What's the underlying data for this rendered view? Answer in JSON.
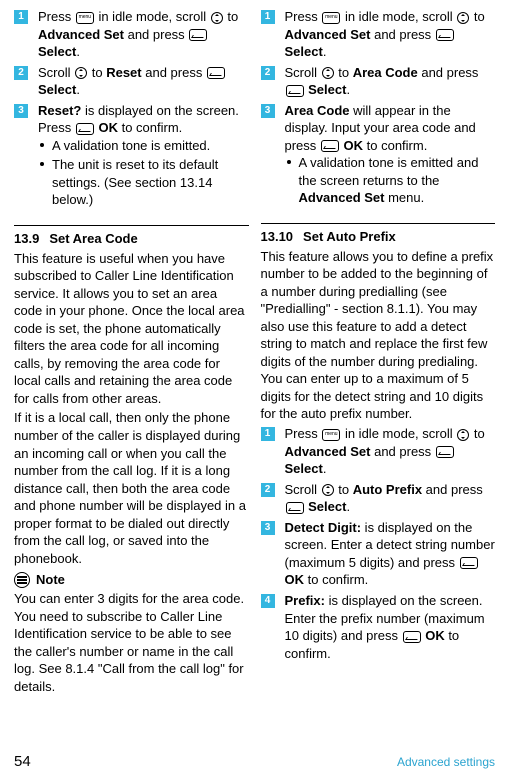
{
  "icons": {
    "menu_text": "menu"
  },
  "left_top_steps": {
    "s1": {
      "num": "1",
      "a": "Press ",
      "b": " in idle mode, scroll ",
      "c": " to",
      "d": "Advanced Set",
      "e": " and press ",
      "f": "Select",
      "g": "."
    },
    "s2": {
      "num": "2",
      "a": "Scroll ",
      "b": " to ",
      "c": "Reset",
      "d": " and press ",
      "e": "Select",
      "f": "."
    },
    "s3": {
      "num": "3",
      "a": "Reset?",
      "b": " is displayed on the screen.",
      "c": "Press ",
      "d": "OK",
      "e": " to confirm."
    },
    "b1": "A validation tone is emitted.",
    "b2": "The unit is reset to its default settings. (See section 13.14 below.)"
  },
  "right_top_steps": {
    "s1": {
      "num": "1",
      "a": "Press ",
      "b": " in idle mode, scroll ",
      "c": " to",
      "d": "Advanced Set",
      "e": " and press ",
      "f": "Select",
      "g": "."
    },
    "s2": {
      "num": "2",
      "a": "Scroll ",
      "b": " to ",
      "c": "Area Code",
      "d": " and press",
      "e": "Select",
      "f": "."
    },
    "s3": {
      "num": "3",
      "a": "Area Code",
      "b": " will appear in the display. Input your area code and press ",
      "c": "OK",
      "d": " to confirm."
    },
    "b1a": "A validation tone is emitted and the screen returns to the",
    "b1b": "Advanced Set",
    "b1c": " menu."
  },
  "left_section": {
    "num": "13.9",
    "title": "Set Area Code",
    "p1": "This feature is useful when you have subscribed to Caller Line Identification service. It allows you to set an area code in your phone. Once the local area code is set, the phone automatically filters the area code for all incoming calls, by removing the area code for local calls and retaining the area code for calls from other areas.",
    "p2": "If it is a local call, then only the phone number of the caller is displayed during an incoming call or when you call the number from the call log. If it is a long distance call, then both the area code and phone number will be displayed in a proper format to be dialed out directly from the call log, or saved into the phonebook.",
    "note_label": "Note",
    "note": "You can enter 3 digits for the area code. You need to subscribe to Caller Line Identification service to be able to see the caller's number or name in the call log. See 8.1.4 \"Call from the call log\" for details."
  },
  "right_section": {
    "num": "13.10",
    "title": "Set Auto Prefix",
    "p1": "This feature allows you to define a prefix number to be added to the beginning of a number during predialling (see \"Predialling\" - section 8.1.1). You may also use this feature to add a detect string to match and replace the first few digits of the number during predialing. You can enter up to a maximum of 5 digits for the detect string and 10 digits for the auto prefix number.",
    "s1": {
      "num": "1",
      "a": "Press ",
      "b": " in idle mode, scroll ",
      "c": " to",
      "d": "Advanced Set",
      "e": " and press ",
      "f": "Select",
      "g": "."
    },
    "s2": {
      "num": "2",
      "a": "Scroll ",
      "b": " to ",
      "c": "Auto Prefix",
      "d": " and press",
      "e": "Select",
      "f": "."
    },
    "s3": {
      "num": "3",
      "a": "Detect Digit:",
      "b": " is displayed on the screen. Enter a detect string number (maximum 5 digits) and press ",
      "c": "OK",
      "d": " to confirm."
    },
    "s4": {
      "num": "4",
      "a": "Prefix:",
      "b": " is displayed on the screen. Enter the prefix number (maximum 10 digits) and press ",
      "c": "OK",
      "d": " to confirm."
    }
  },
  "footer": {
    "page": "54",
    "label": "Advanced settings"
  }
}
